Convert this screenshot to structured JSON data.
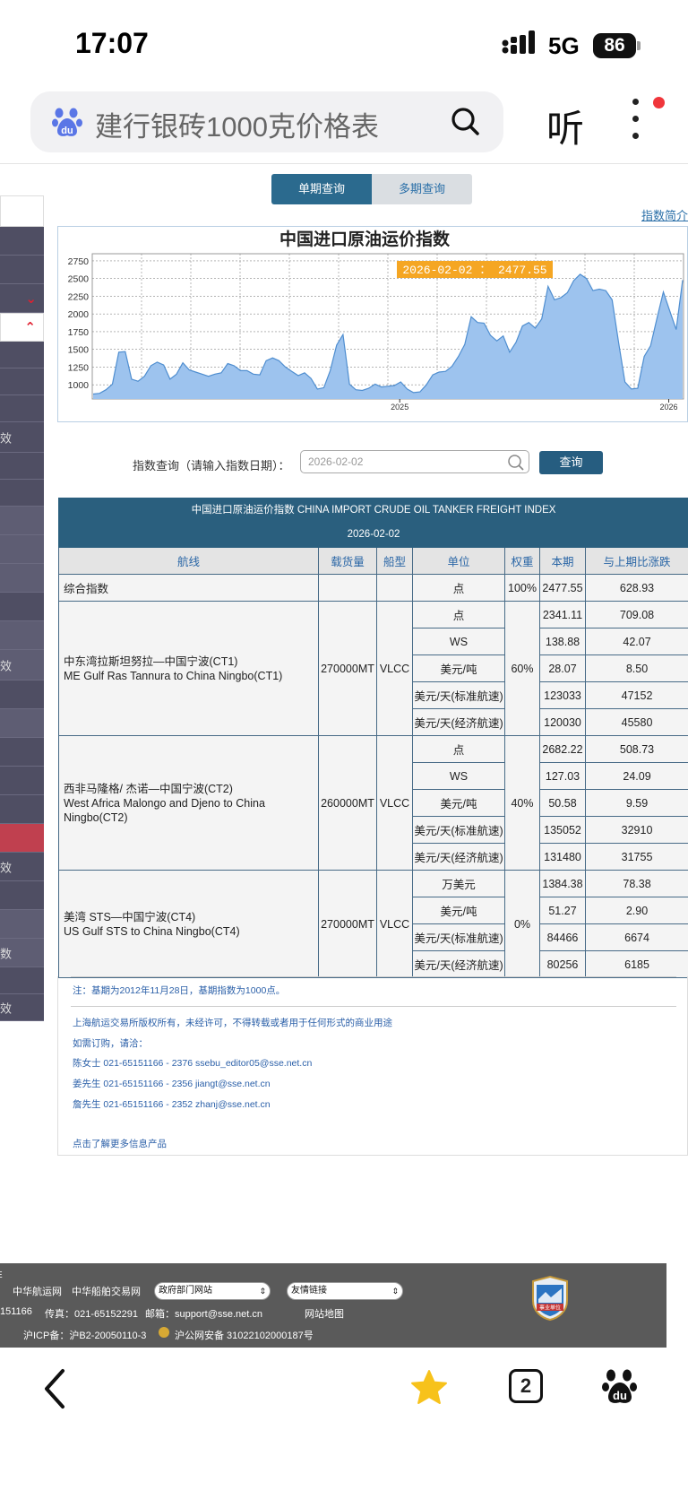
{
  "status": {
    "time": "17:07",
    "network": "5G",
    "battery": "86"
  },
  "search": {
    "query": "建行银砖1000克价格表",
    "listen_label": "听"
  },
  "tabs": {
    "single": "单期查询",
    "multi": "多期查询"
  },
  "intro_link": "指数简介",
  "chart_data": {
    "type": "area",
    "title": "中国进口原油运价指数",
    "tooltip": "2026-02-02 ： 2477.55",
    "y_ticks": [
      "2750",
      "2500",
      "2250",
      "2000",
      "1750",
      "1500",
      "1250",
      "1000"
    ],
    "x_ticks": [
      "2025",
      "2026"
    ],
    "ylim": [
      800,
      2850
    ],
    "fill_color": "#9dc3ee",
    "line_color": "#4f8ed0",
    "values": [
      870,
      880,
      930,
      1010,
      1460,
      1470,
      1080,
      1050,
      1120,
      1270,
      1320,
      1280,
      1080,
      1150,
      1310,
      1210,
      1180,
      1150,
      1120,
      1150,
      1170,
      1300,
      1270,
      1200,
      1200,
      1150,
      1140,
      1340,
      1380,
      1340,
      1250,
      1190,
      1130,
      1170,
      1090,
      940,
      960,
      1200,
      1560,
      1710,
      1010,
      930,
      920,
      950,
      1010,
      970,
      980,
      990,
      1040,
      940,
      890,
      900,
      1000,
      1140,
      1180,
      1190,
      1260,
      1400,
      1570,
      1960,
      1880,
      1870,
      1700,
      1620,
      1690,
      1460,
      1600,
      1830,
      1880,
      1800,
      1930,
      2390,
      2200,
      2230,
      2300,
      2470,
      2560,
      2500,
      2330,
      2350,
      2330,
      2200,
      1600,
      1040,
      940,
      950,
      1400,
      1550,
      1940,
      2310,
      2040,
      1780,
      2477.55
    ]
  },
  "query": {
    "label": "指数查询（请输入指数日期）：",
    "placeholder": "2026-02-02",
    "button": "查询"
  },
  "table": {
    "title": "中国进口原油运价指数 CHINA IMPORT CRUDE OIL TANKER FREIGHT INDEX",
    "date": "2026-02-02",
    "headers": [
      "航线",
      "载货量",
      "船型",
      "单位",
      "权重",
      "本期",
      "与上期比涨跌"
    ],
    "composite": {
      "name": "综合指数",
      "unit": "点",
      "weight": "100%",
      "current": "2477.55",
      "change": "628.93"
    },
    "routes": [
      {
        "name_cn": "中东湾拉斯坦努拉—中国宁波(CT1)",
        "name_en": "ME Gulf Ras Tannura to China Ningbo(CT1)",
        "cargo": "270000MT",
        "ship": "VLCC",
        "weight": "60%",
        "rows": [
          {
            "unit": "点",
            "current": "2341.11",
            "change": "709.08"
          },
          {
            "unit": "WS",
            "current": "138.88",
            "change": "42.07"
          },
          {
            "unit": "美元/吨",
            "current": "28.07",
            "change": "8.50"
          },
          {
            "unit": "美元/天(标准航速)",
            "current": "123033",
            "change": "47152"
          },
          {
            "unit": "美元/天(经济航速)",
            "current": "120030",
            "change": "45580"
          }
        ]
      },
      {
        "name_cn": "西非马隆格/ 杰诺—中国宁波(CT2)",
        "name_en": "West Africa Malongo and Djeno to China Ningbo(CT2)",
        "cargo": "260000MT",
        "ship": "VLCC",
        "weight": "40%",
        "rows": [
          {
            "unit": "点",
            "current": "2682.22",
            "change": "508.73"
          },
          {
            "unit": "WS",
            "current": "127.03",
            "change": "24.09"
          },
          {
            "unit": "美元/吨",
            "current": "50.58",
            "change": "9.59"
          },
          {
            "unit": "美元/天(标准航速)",
            "current": "135052",
            "change": "32910"
          },
          {
            "unit": "美元/天(经济航速)",
            "current": "131480",
            "change": "31755"
          }
        ]
      },
      {
        "name_cn": "美湾 STS—中国宁波(CT4)",
        "name_en": "US Gulf STS to China Ningbo(CT4)",
        "cargo": "270000MT",
        "ship": "VLCC",
        "weight": "0%",
        "rows": [
          {
            "unit": "万美元",
            "current": "1384.38",
            "change": "78.38"
          },
          {
            "unit": "美元/吨",
            "current": "51.27",
            "change": "2.90"
          },
          {
            "unit": "美元/天(标准航速)",
            "current": "84466",
            "change": "6674"
          },
          {
            "unit": "美元/天(经济航速)",
            "current": "80256",
            "change": "6185"
          }
        ]
      }
    ]
  },
  "notes": {
    "base": "注：基期为2012年11月28日，基期指数为1000点。",
    "copyright": "上海航运交易所版权所有，未经许可，不得转载或者用于任何形式的商业用途",
    "contact_intro": "如需订购，请洽：",
    "contacts": [
      "陈女士 021-65151166 - 2376 ssebu_editor05@sse.net.cn",
      "姜先生 021-65151166 - 2356 jiangt@sse.net.cn",
      "詹先生 021-65151166 - 2352 zhanj@sse.net.cn"
    ],
    "more_link": "点击了解更多信息产品"
  },
  "footer": {
    "edge_top": "E",
    "link1": "中华航运网",
    "link2": "中华船舶交易网",
    "select1": "政府部门网站",
    "select2": "友情链接",
    "phone_tail": "151166",
    "fax": "传真：021-65152291",
    "email": "邮箱：support@sse.net.cn",
    "sitemap": "网站地图",
    "icp": "沪ICP备：沪B2-20050110-3",
    "police": "沪公网安备 31022102000187号",
    "badge": "事业单位"
  },
  "sidebar": {
    "fragments": [
      "效",
      "效",
      "数",
      "效"
    ]
  },
  "bottom_nav": {
    "tab_count": "2"
  }
}
